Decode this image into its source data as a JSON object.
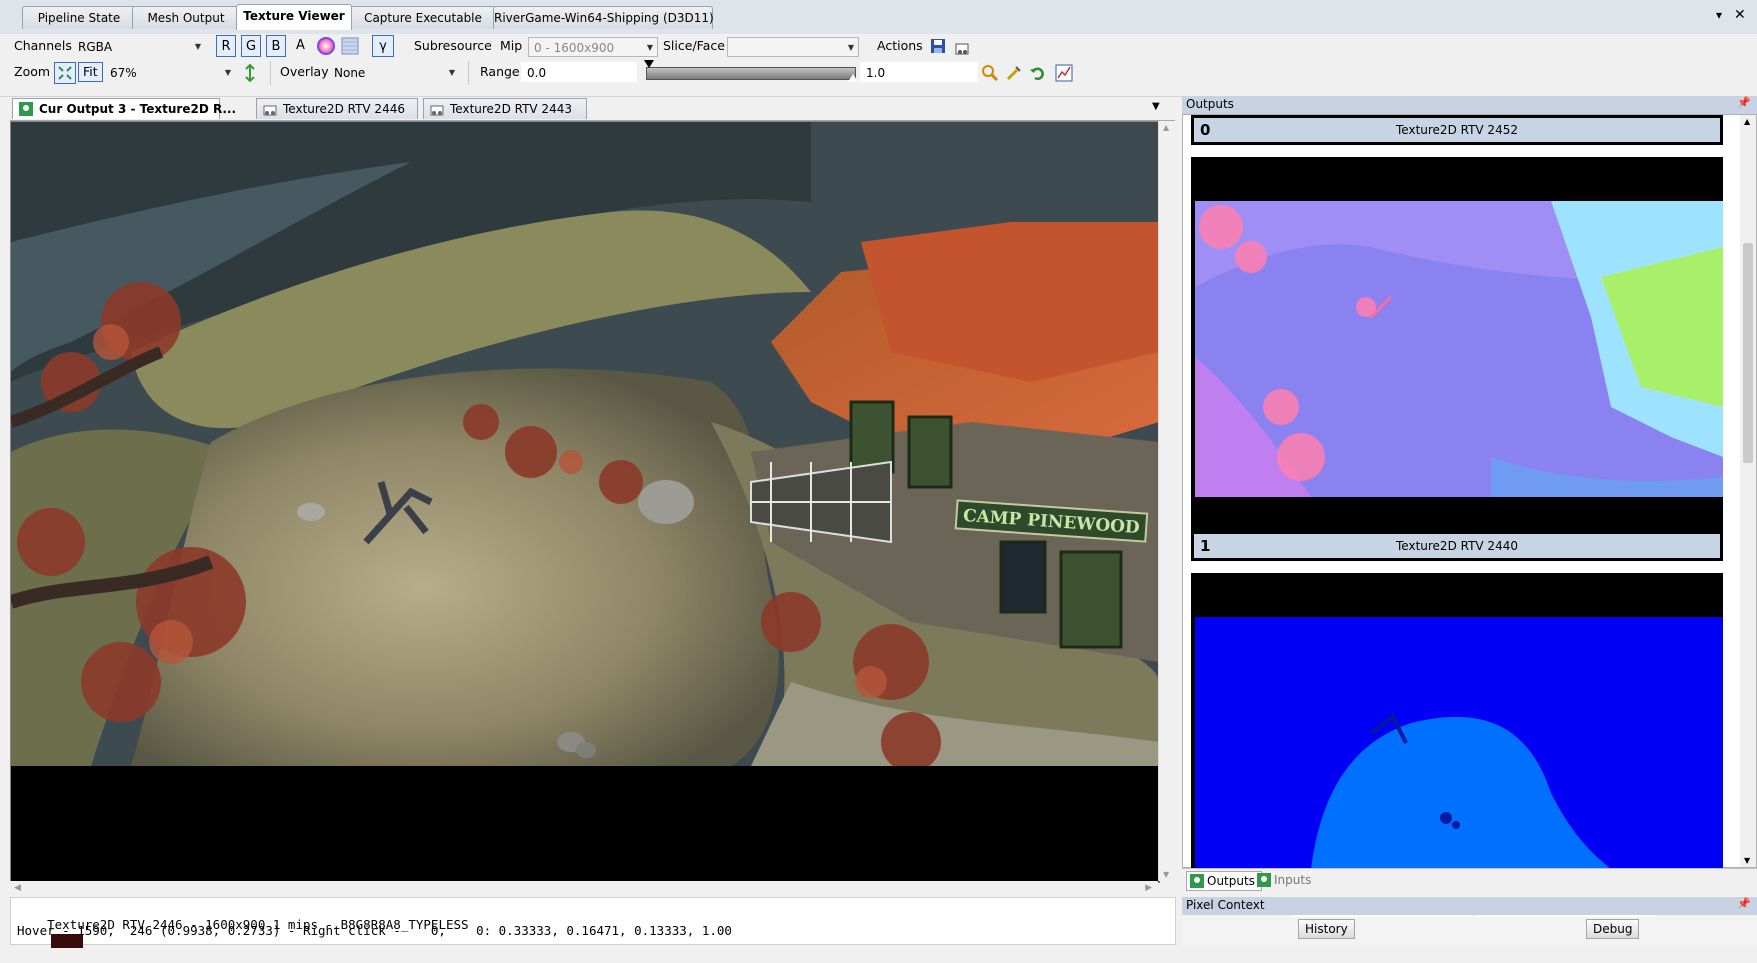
{
  "doc_tabs": [
    "Pipeline State",
    "Mesh Output",
    "Texture Viewer",
    "Capture Executable",
    "RiverGame-Win64-Shipping (D3D11)"
  ],
  "window_controls": {
    "dropdown": "▾",
    "close": "✕"
  },
  "toolbar": {
    "channels_label": "Channels",
    "channels_value": "RGBA",
    "channel_buttons": [
      "R",
      "G",
      "B"
    ],
    "alpha_label": "A",
    "gamma_label": "γ",
    "subresource_label": "Subresource",
    "mip_label": "Mip",
    "mip_value": "0 - 1600x900",
    "slice_label": "Slice/Face",
    "slice_value": "",
    "actions_label": "Actions",
    "zoom_label": "Zoom",
    "fit_label": "Fit",
    "zoom_value": "67%",
    "overlay_label": "Overlay",
    "overlay_value": "None",
    "range_label": "Range",
    "range_min": "0.0",
    "range_max": "1.0"
  },
  "viewer_tabs": [
    "Cur Output 3 - Texture2D R...",
    "Texture2D RTV 2446",
    "Texture2D RTV 2443"
  ],
  "scene": {
    "sign_text": "CAMP PINEWOOD"
  },
  "status": {
    "line1": "Texture2D RTV 2446 - 1600x900 1 mips - B8G8R8A8_TYPELESS",
    "swatch_color": "#3a0b0b",
    "line2": "Hover - 1590,  246 (0.9938, 0.2733) - Right click -    0,    0: 0.33333, 0.16471, 0.13333, 1.00"
  },
  "outputs_panel": {
    "title": "Outputs",
    "items": [
      {
        "index": "0",
        "label": "Texture2D RTV 2452"
      },
      {
        "index": "1",
        "label": "Texture2D RTV 2440"
      }
    ],
    "bottom_tabs": [
      "Outputs",
      "Inputs"
    ]
  },
  "pixel_context": {
    "title": "Pixel Context",
    "buttons": [
      "History",
      "Debug"
    ]
  }
}
